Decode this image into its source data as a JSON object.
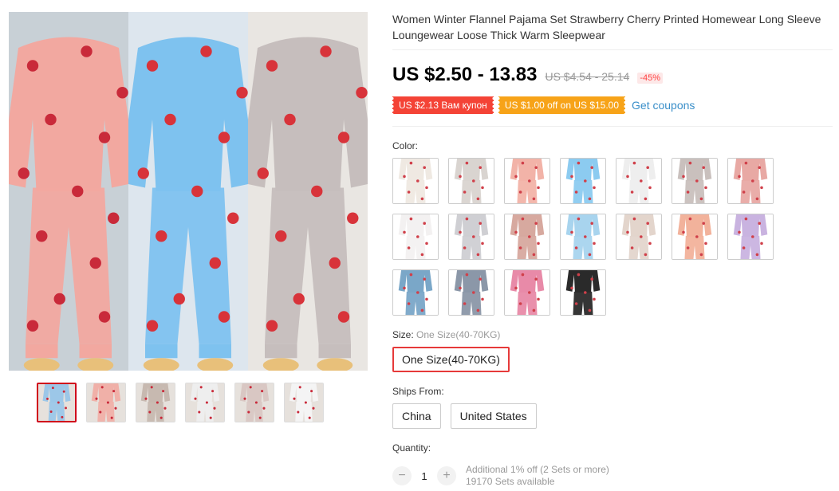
{
  "product": {
    "title": "Women Winter Flannel Pajama Set Strawberry Cherry Printed Homewear Long Sleeve Loungewear Loose Thick Warm Sleepwear",
    "price": "US $2.50 - 13.83",
    "old_price": "US $4.54 - 25.14",
    "discount": "-45%"
  },
  "coupons": {
    "store_coupon": "US $2.13 Вам купон",
    "offer_coupon": "US $1.00 off on US $15.00",
    "get_coupons": "Get coupons"
  },
  "color": {
    "label": "Color:",
    "swatches": [
      {
        "name": "cream-cherry",
        "color": "#efe9e2"
      },
      {
        "name": "grey-small",
        "color": "#d9d4d0"
      },
      {
        "name": "pink-cherry",
        "color": "#f2b3a8"
      },
      {
        "name": "blue-strawberry",
        "color": "#8ccbf0"
      },
      {
        "name": "white-strawberry",
        "color": "#eeeeee"
      },
      {
        "name": "grey-strawberry",
        "color": "#c9c0bd"
      },
      {
        "name": "pink-rose",
        "color": "#e8a9a4"
      },
      {
        "name": "white-seated",
        "color": "#f3f1f1"
      },
      {
        "name": "grey-seated",
        "color": "#cfcfd3"
      },
      {
        "name": "dusty-pink",
        "color": "#d7a99f"
      },
      {
        "name": "light-blue",
        "color": "#a8d4ee"
      },
      {
        "name": "beige-lounge",
        "color": "#e3d5cc"
      },
      {
        "name": "peach",
        "color": "#f2b29b"
      },
      {
        "name": "lavender",
        "color": "#c9b3e0"
      },
      {
        "name": "denim-blue",
        "color": "#7aa7c8"
      },
      {
        "name": "grey-blue",
        "color": "#8b97a8"
      },
      {
        "name": "rose-pink",
        "color": "#e88aa8"
      },
      {
        "name": "black-lingerie",
        "color": "#2a2a2a"
      }
    ]
  },
  "size": {
    "label": "Size:",
    "selected": "One Size(40-70KG)",
    "option": "One Size(40-70KG)"
  },
  "ships_from": {
    "label": "Ships From:",
    "options": [
      "China",
      "United States"
    ]
  },
  "quantity": {
    "label": "Quantity:",
    "minus": "−",
    "value": "1",
    "plus": "+",
    "note1": "Additional 1% off (2 Sets or more)",
    "note2": "19170 Sets available"
  },
  "gallery": {
    "panels": [
      {
        "name": "pink-cherry",
        "color": "#f2a8a0",
        "dot": "#c92a3a"
      },
      {
        "name": "blue-strawberry",
        "color": "#7ec2ef",
        "dot": "#d8333a"
      },
      {
        "name": "grey-strawberry",
        "color": "#c6bebd",
        "dot": "#d8333a"
      }
    ],
    "thumbs": [
      {
        "name": "thumb-1",
        "color": "#9cc7e8"
      },
      {
        "name": "thumb-2",
        "color": "#f0b0a8"
      },
      {
        "name": "thumb-3",
        "color": "#c7b9b0"
      },
      {
        "name": "thumb-4",
        "color": "#eeeeee"
      },
      {
        "name": "thumb-5",
        "color": "#d9c7c3"
      },
      {
        "name": "thumb-6",
        "color": "#f4f4f4"
      }
    ]
  }
}
